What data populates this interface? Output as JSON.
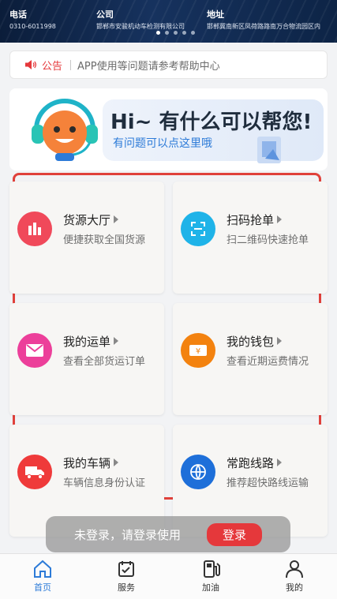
{
  "banner": {
    "phone_label": "电话",
    "phone_value": "0310-6011998",
    "company_label": "公司",
    "company_value": "邯郸市安骏机动车检测有限公司",
    "address_label": "地址",
    "address_value": "邯郸冀南新区凤荷路路南万合物流园区内"
  },
  "notice": {
    "tag": "公告",
    "message": "APP使用等问题请参考帮助中心"
  },
  "help": {
    "title": "Hi~ 有什么可以帮您!",
    "subtitle": "有问题可以点这里哦"
  },
  "services": [
    {
      "title": "货源大厅",
      "subtitle": "便捷获取全国货源",
      "icon": "cargo-hall-icon",
      "color": "#f0495a"
    },
    {
      "title": "扫码抢单",
      "subtitle": "扫二维码快速抢单",
      "icon": "scan-icon",
      "color": "#1fb3e8"
    },
    {
      "title": "我的运单",
      "subtitle": "查看全部货运订单",
      "icon": "envelope-icon",
      "color": "#ec3f9a"
    },
    {
      "title": "我的钱包",
      "subtitle": "查看近期运费情况",
      "icon": "wallet-icon",
      "color": "#f3820f"
    },
    {
      "title": "我的车辆",
      "subtitle": "车辆信息身份认证",
      "icon": "truck-icon",
      "color": "#ef3a3a"
    },
    {
      "title": "常跑线路",
      "subtitle": "推荐超快路线运输",
      "icon": "route-icon",
      "color": "#1e6fd9"
    }
  ],
  "toast": {
    "message": "未登录，请登录使用",
    "login_label": "登录"
  },
  "tabbar": {
    "items": [
      {
        "label": "首页",
        "icon": "home-icon",
        "active": true
      },
      {
        "label": "服务",
        "icon": "service-icon",
        "active": false
      },
      {
        "label": "加油",
        "icon": "fuel-icon",
        "active": false
      },
      {
        "label": "我的",
        "icon": "user-icon",
        "active": false
      }
    ]
  },
  "colors": {
    "accent": "#2d7bd8",
    "alert": "#e5383b"
  }
}
